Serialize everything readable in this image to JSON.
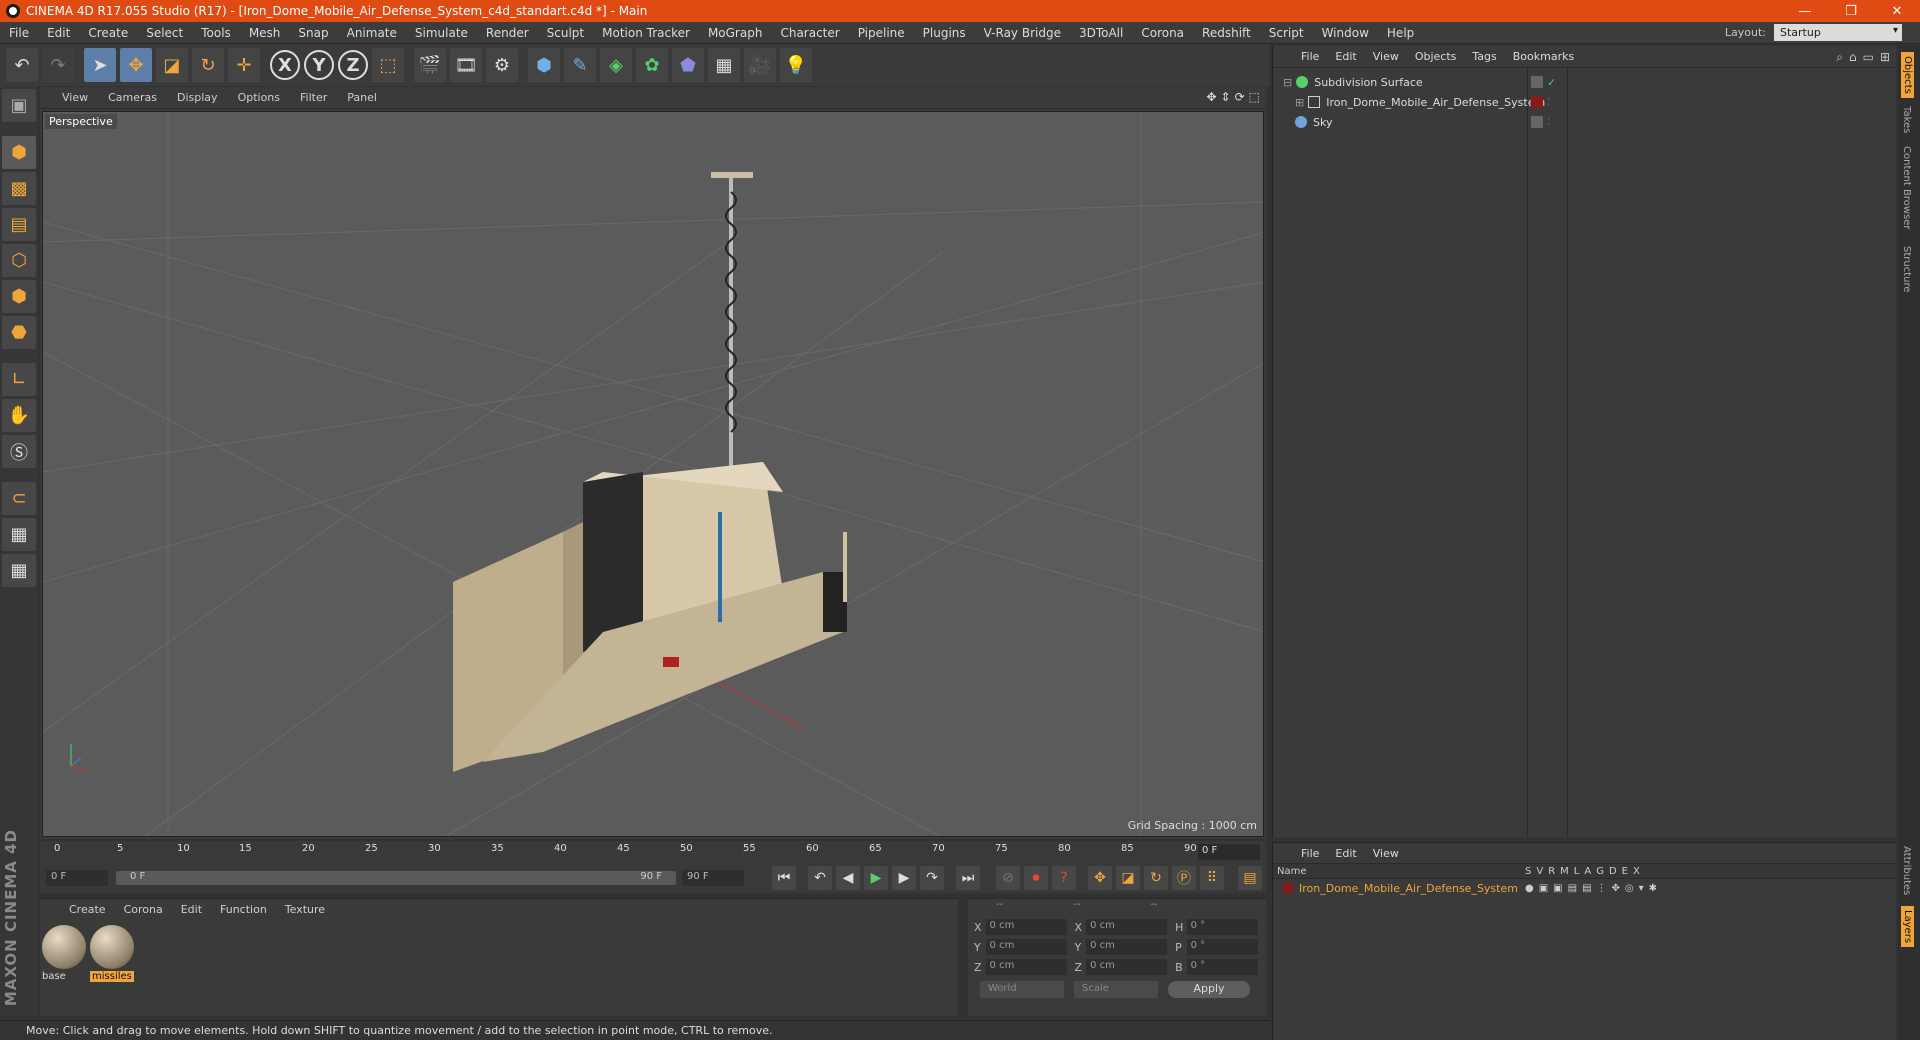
{
  "window": {
    "title": "CINEMA 4D R17.055 Studio (R17) - [Iron_Dome_Mobile_Air_Defense_System_c4d_standart.c4d *] - Main",
    "controls": [
      "—",
      "❐",
      "✕"
    ]
  },
  "menubar": {
    "items": [
      "File",
      "Edit",
      "Create",
      "Select",
      "Tools",
      "Mesh",
      "Snap",
      "Animate",
      "Simulate",
      "Render",
      "Sculpt",
      "Motion Tracker",
      "MoGraph",
      "Character",
      "Pipeline",
      "Plugins",
      "V-Ray Bridge",
      "3DToAll",
      "Corona",
      "Redshift",
      "Script",
      "Window",
      "Help"
    ],
    "layout_label": "Layout:",
    "layout_value": "Startup"
  },
  "viewport": {
    "menu": [
      "View",
      "Cameras",
      "Display",
      "Options",
      "Filter",
      "Panel"
    ],
    "label": "Perspective",
    "grid_spacing": "Grid Spacing : 1000 cm"
  },
  "timeline": {
    "ticks": [
      "0",
      "5",
      "10",
      "15",
      "20",
      "25",
      "30",
      "35",
      "40",
      "45",
      "50",
      "55",
      "60",
      "65",
      "70",
      "75",
      "80",
      "85",
      "90"
    ],
    "current_frame": "0 F"
  },
  "playbar": {
    "start": "0 F",
    "slider_start": "0 F",
    "slider_end": "90 F",
    "end": "90 F"
  },
  "material_manager": {
    "menu": [
      "Create",
      "Corona",
      "Edit",
      "Function",
      "Texture"
    ],
    "materials": [
      {
        "name": "base",
        "selected": false
      },
      {
        "name": "missiles",
        "selected": true
      }
    ]
  },
  "coordinates": {
    "header": [
      "--",
      "--",
      "--"
    ],
    "rows": [
      {
        "a": "X",
        "v1": "0 cm",
        "b": "X",
        "v2": "0 cm",
        "c": "H",
        "v3": "0 °"
      },
      {
        "a": "Y",
        "v1": "0 cm",
        "b": "Y",
        "v2": "0 cm",
        "c": "P",
        "v3": "0 °"
      },
      {
        "a": "Z",
        "v1": "0 cm",
        "b": "Z",
        "v2": "0 cm",
        "c": "B",
        "v3": "0 °"
      }
    ],
    "mode": "World",
    "transform": "Scale",
    "apply": "Apply"
  },
  "status": "Move: Click and drag to move elements. Hold down SHIFT to quantize movement / add to the selection in point mode, CTRL to remove.",
  "object_manager": {
    "menu": [
      "File",
      "Edit",
      "View",
      "Objects",
      "Tags",
      "Bookmarks"
    ],
    "objects": [
      {
        "name": "Subdivision Surface",
        "color": "#56d06a"
      },
      {
        "name": "Iron_Dome_Mobile_Air_Defense_System",
        "color": "#cfcfcf"
      },
      {
        "name": "Sky",
        "color": "#6fa3d9"
      }
    ]
  },
  "layer_manager": {
    "menu": [
      "File",
      "Edit",
      "View"
    ],
    "header_name": "Name",
    "columns": [
      "S",
      "V",
      "R",
      "M",
      "L",
      "A",
      "G",
      "D",
      "E",
      "X"
    ],
    "layers": [
      {
        "name": "Iron_Dome_Mobile_Air_Defense_System",
        "color": "#8b1a1a"
      }
    ]
  },
  "side_tabs": [
    "Objects",
    "Takes",
    "Content Browser",
    "Structure",
    "Attributes",
    "Layers"
  ],
  "branding": {
    "logo": "MAXON CINEMA 4D"
  },
  "colors": {
    "accent": "#e04a13",
    "highlight": "#f0a53a",
    "viewport": "#5b5b5b"
  }
}
